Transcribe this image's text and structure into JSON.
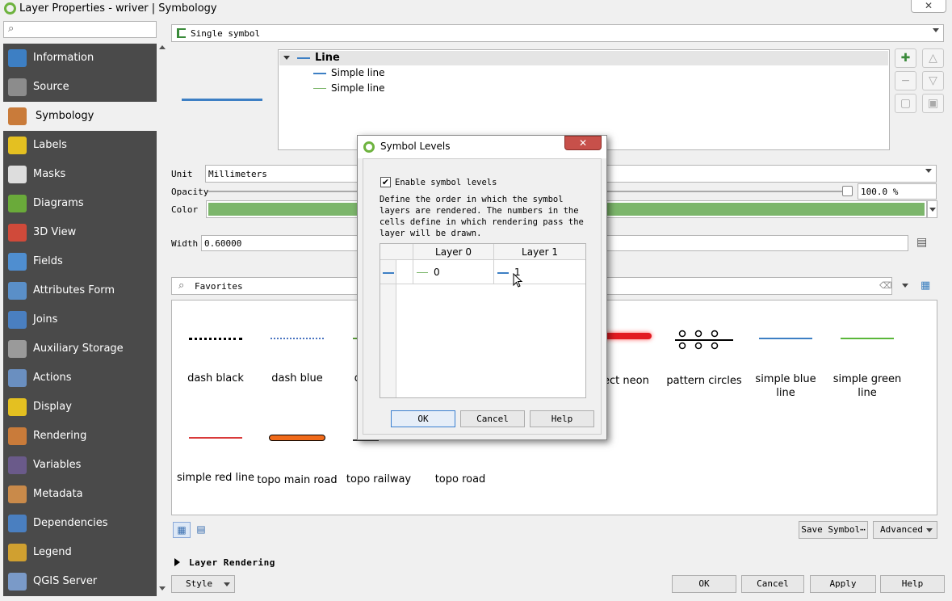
{
  "window": {
    "title": "Layer Properties - wriver | Symbology",
    "close": "✕"
  },
  "search": {
    "placeholder": ""
  },
  "sidebar": {
    "items": [
      {
        "label": "Information",
        "icon": "information-icon",
        "color": "#3d7fc4"
      },
      {
        "label": "Source",
        "icon": "source-icon",
        "color": "#8c8c8c"
      },
      {
        "label": "Symbology",
        "icon": "symbology-icon",
        "color": "#c97b3a",
        "selected": true
      },
      {
        "label": "Labels",
        "icon": "labels-icon",
        "color": "#e4c021"
      },
      {
        "label": "Masks",
        "icon": "masks-icon",
        "color": "#dddddd"
      },
      {
        "label": "Diagrams",
        "icon": "diagrams-icon",
        "color": "#6aaa3a"
      },
      {
        "label": "3D View",
        "icon": "3d-view-icon",
        "color": "#d04a3a"
      },
      {
        "label": "Fields",
        "icon": "fields-icon",
        "color": "#4f8ed0"
      },
      {
        "label": "Attributes Form",
        "icon": "attributes-form-icon",
        "color": "#5a8fc8"
      },
      {
        "label": "Joins",
        "icon": "joins-icon",
        "color": "#4a7fc0"
      },
      {
        "label": "Auxiliary Storage",
        "icon": "auxiliary-storage-icon",
        "color": "#9a9a9a"
      },
      {
        "label": "Actions",
        "icon": "actions-icon",
        "color": "#6a8fc0"
      },
      {
        "label": "Display",
        "icon": "display-icon",
        "color": "#e4c021"
      },
      {
        "label": "Rendering",
        "icon": "rendering-icon",
        "color": "#c97b3a"
      },
      {
        "label": "Variables",
        "icon": "variables-icon",
        "color": "#6a5a8a"
      },
      {
        "label": "Metadata",
        "icon": "metadata-icon",
        "color": "#c98a4a"
      },
      {
        "label": "Dependencies",
        "icon": "dependencies-icon",
        "color": "#4a7fc0"
      },
      {
        "label": "Legend",
        "icon": "legend-icon",
        "color": "#d0a030"
      },
      {
        "label": "QGIS Server",
        "icon": "qgis-server-icon",
        "color": "#7a9ac8"
      }
    ]
  },
  "symbology": {
    "renderer": "Single symbol",
    "tree": {
      "root": "Line",
      "children": [
        "Simple line",
        "Simple line"
      ]
    },
    "unit_label": "Unit",
    "unit_value": "Millimeters",
    "opacity_label": "Opacity",
    "opacity_value": "100.0 %",
    "color_label": "Color",
    "color_value": "#7cb66b",
    "width_label": "Width",
    "width_value": "0.60000",
    "favorites": "Favorites",
    "save_symbol": "Save Symbol⋯",
    "advanced": "Advanced"
  },
  "gallery": [
    {
      "label": "dash  black"
    },
    {
      "label": "dash blue"
    },
    {
      "label": "d"
    },
    {
      "label": "ect neon"
    },
    {
      "label": "pattern circles"
    },
    {
      "label": "simple blue line"
    },
    {
      "label": "simple green line"
    },
    {
      "label": "simple red line"
    },
    {
      "label": "topo main road"
    },
    {
      "label": "topo railway"
    },
    {
      "label": "topo road"
    }
  ],
  "layer_rendering": "Layer Rendering",
  "footer": {
    "style": "Style",
    "ok": "OK",
    "cancel": "Cancel",
    "apply": "Apply",
    "help": "Help"
  },
  "dialog": {
    "title": "Symbol Levels",
    "close": "✕",
    "enable_label": "Enable symbol levels",
    "enable_checked": true,
    "description": "Define the order in which the symbol layers are rendered. The numbers in the cells define in which rendering pass the layer will be drawn.",
    "headers": [
      "Layer 0",
      "Layer 1"
    ],
    "row": [
      "0",
      "1"
    ],
    "ok": "OK",
    "cancel": "Cancel",
    "help": "Help"
  }
}
